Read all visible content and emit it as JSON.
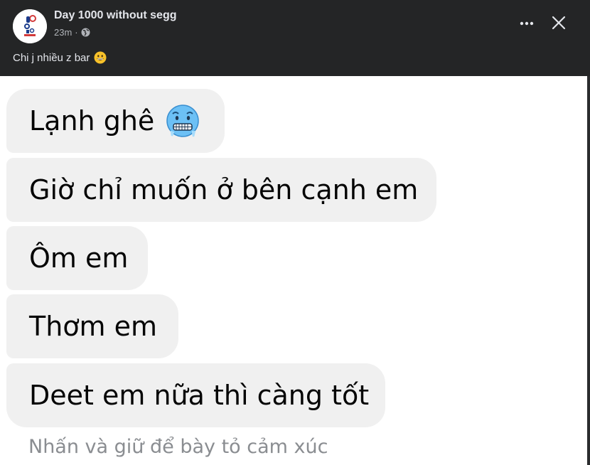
{
  "post": {
    "page_name": "Day 1000 without segg",
    "time": "23m",
    "separator": "·",
    "caption": "Chi j nhiều z bar",
    "avatar_icon": "logo-avatar-icon",
    "privacy_icon": "globe-icon",
    "caption_emoji": "grinning-face-icon"
  },
  "header_actions": {
    "more_icon": "more-icon",
    "close_icon": "close-icon"
  },
  "chat": {
    "messages": [
      {
        "text": "Lạnh ghê",
        "emoji": "cold-face-icon"
      },
      {
        "text": "Giờ chỉ muốn ở bên cạnh em"
      },
      {
        "text": "Ôm em"
      },
      {
        "text": "Thơm em"
      },
      {
        "text": "Deet em nữa thì càng tốt"
      }
    ],
    "hint": "Nhấn và giữ để bày tỏ cảm xúc"
  },
  "colors": {
    "dark_bg": "#242526",
    "bubble_bg": "#f0f0f0",
    "text_light": "#e4e6eb",
    "text_muted": "#b0b3b8",
    "cold_emoji": "#5ab4f0"
  }
}
